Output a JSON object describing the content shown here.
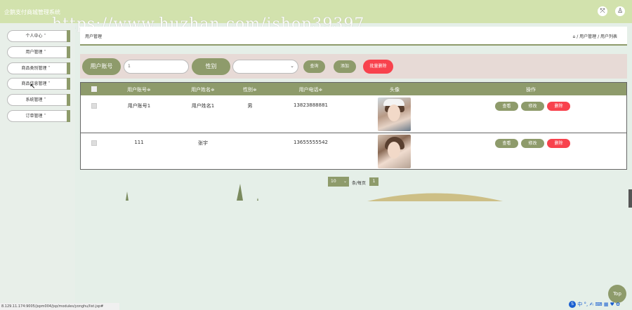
{
  "app": {
    "title": "企鹅支付商城管理系统",
    "watermark": "https://www.huzhan.com/ishop39397"
  },
  "header": {
    "icons": [
      {
        "name": "fullscreen-icon",
        "glyph": "⤧"
      },
      {
        "name": "user-icon",
        "glyph": "♙"
      }
    ]
  },
  "sidebar": {
    "items": [
      {
        "label": "个人中心 ˅"
      },
      {
        "label": "用户管理 ˅"
      },
      {
        "label": "商品类别管理 ˅"
      },
      {
        "label": "商品信息管理 ˅"
      },
      {
        "label": "系统管理 ˅"
      },
      {
        "label": "订单管理 ˅"
      }
    ]
  },
  "breadcrumb": {
    "page_title": "用户管理",
    "home_icon": "⌂",
    "path": "/ 用户管理 / 用户列表"
  },
  "search": {
    "account_label": "用户账号",
    "account_value": "1",
    "gender_label": "性别",
    "gender_value": "",
    "query_button": "查询",
    "add_button": "添加",
    "batch_delete_button": "批量删除"
  },
  "table": {
    "headers": {
      "account": "用户账号≑",
      "name": "用户姓名≑",
      "gender": "性别≑",
      "phone": "用户电话≑",
      "avatar": "头像",
      "actions": "操作"
    },
    "rows": [
      {
        "account": "用户账号1",
        "name": "用户姓名1",
        "gender": "男",
        "phone": "13823888881"
      },
      {
        "account": "111",
        "name": "张宇",
        "gender": "",
        "phone": "13655555542"
      }
    ],
    "action_labels": {
      "view": "查看",
      "edit": "修改",
      "delete": "删除"
    }
  },
  "pagination": {
    "page_size": "10",
    "page_size_label": "条/每页",
    "current_page": "1"
  },
  "status_url": "8.129.11.174:9005/jspm004/jsp/modules/yonghu/list.jsp#",
  "top_button": "Top",
  "tray": {
    "logo": "S",
    "items": "中 °, ✍ ⌨ ▦ ♥ ✿"
  },
  "colors": {
    "topbar": "#d2e2ad",
    "accent": "#8e9b6b",
    "danger": "#f8424d",
    "searchbar": "#e7dad6",
    "background": "#e5efe8"
  }
}
